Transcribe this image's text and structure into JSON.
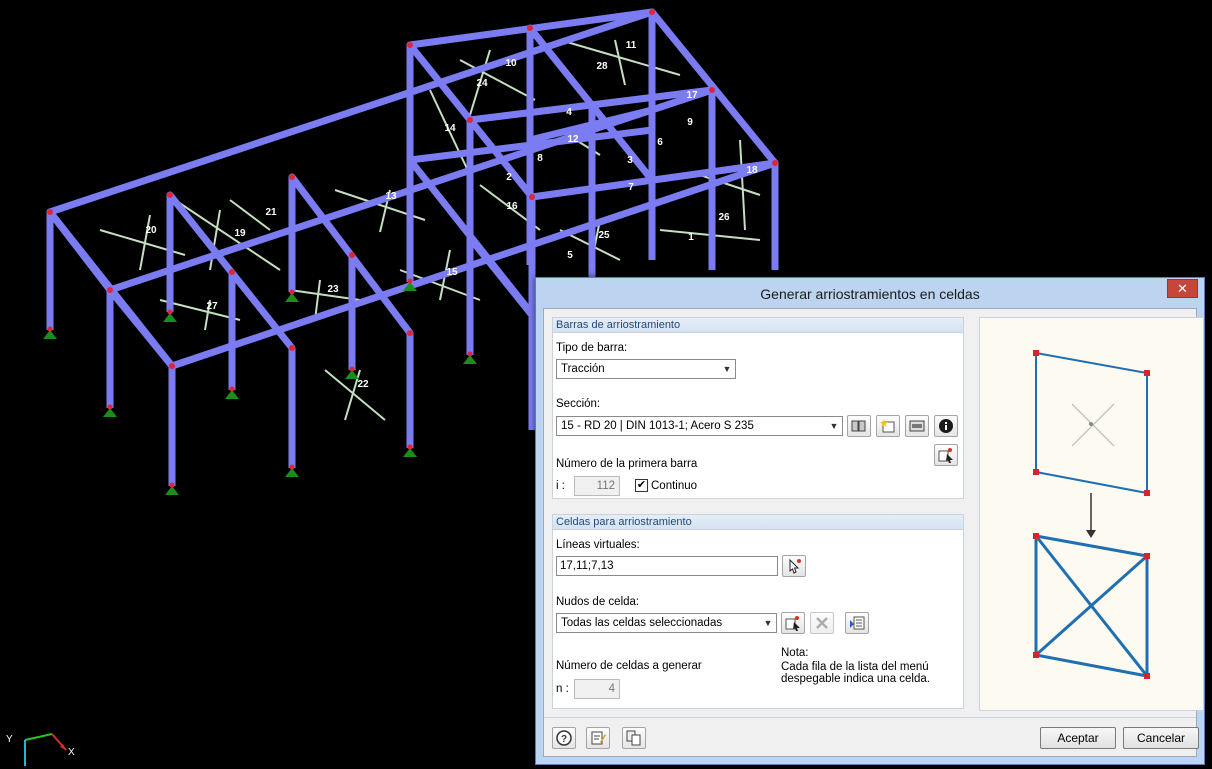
{
  "model": {
    "member_numbers": [
      "11",
      "10",
      "28",
      "24",
      "17",
      "4",
      "9",
      "14",
      "12",
      "6",
      "3",
      "8",
      "2",
      "7",
      "18",
      "13",
      "21",
      "16",
      "26",
      "20",
      "19",
      "25",
      "1",
      "5",
      "15",
      "27",
      "23",
      "22"
    ],
    "axes": {
      "y_label": "Y",
      "x_label": "X"
    },
    "colors": {
      "member": "#7b7cf2",
      "bracing": "#c6dfc2",
      "support": "#1a8d1a",
      "node": "#e0253b"
    }
  },
  "dialog": {
    "title": "Generar arriostramientos en celdas",
    "close_glyph": "✕",
    "bracing_group": {
      "header": "Barras de arriostramiento",
      "member_type_label": "Tipo de barra:",
      "member_type_value": "Tracción",
      "section_label": "Sección:",
      "section_value": "15 - RD 20 | DIN 1013-1; Acero S 235",
      "first_member_label": "Número de la primera barra",
      "first_member_prefix": "i :",
      "first_member_value": "112",
      "continuous_label": "Continuo",
      "continuous_checked": true
    },
    "cells_group": {
      "header": "Celdas para arriostramiento",
      "virtual_lines_label": "Líneas virtuales:",
      "virtual_lines_value": "17,11;7,13",
      "cell_nodes_label": "Nudos de celda:",
      "cell_nodes_value": "Todas las celdas seleccionadas",
      "count_label": "Número de celdas a generar",
      "count_prefix": "n :",
      "count_value": "4",
      "note_title": "Nota:",
      "note_line1": "Cada fila de la lista del menú",
      "note_line2": "despegable indica una celda."
    },
    "buttons": {
      "ok": "Aceptar",
      "cancel": "Cancelar"
    }
  }
}
